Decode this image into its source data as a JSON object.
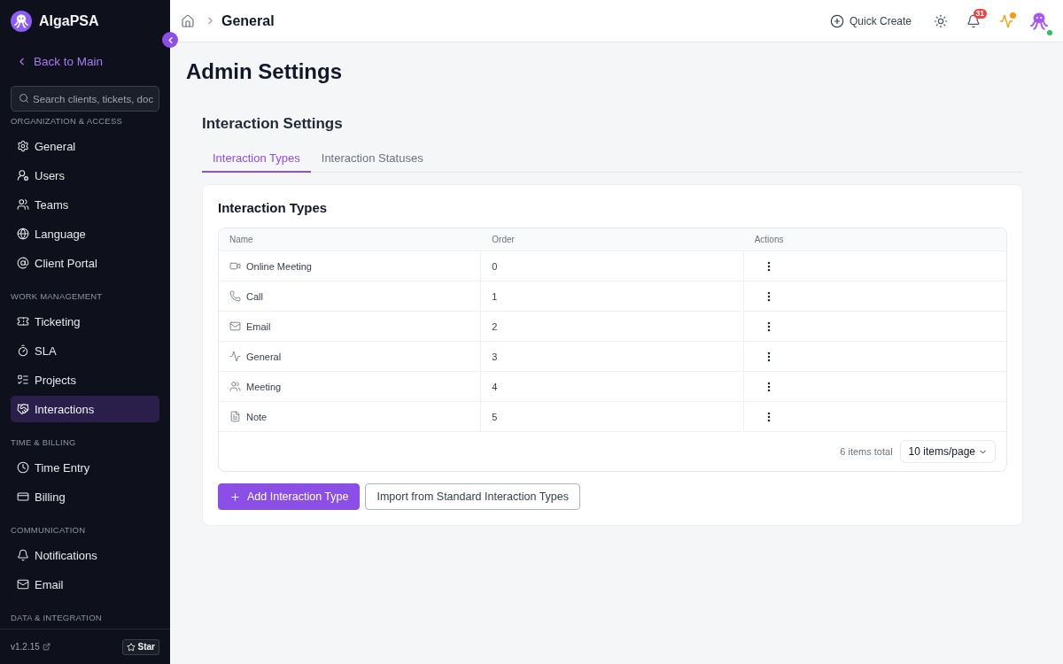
{
  "sidebar": {
    "brand": "AlgaPSA",
    "back_link": "Back to Main",
    "search": {
      "placeholder": "Search clients, tickets, doc"
    },
    "sections": [
      {
        "title": "ORGANIZATION & ACCESS",
        "items": [
          {
            "label": "General",
            "selected": false
          },
          {
            "label": "Users",
            "selected": false
          },
          {
            "label": "Teams",
            "selected": false
          },
          {
            "label": "Language",
            "selected": false
          },
          {
            "label": "Client Portal",
            "selected": false
          }
        ]
      },
      {
        "title": "WORK MANAGEMENT",
        "items": [
          {
            "label": "Ticketing",
            "selected": false
          },
          {
            "label": "SLA",
            "selected": false
          },
          {
            "label": "Projects",
            "selected": false
          },
          {
            "label": "Interactions",
            "selected": true
          }
        ]
      },
      {
        "title": "TIME & BILLING",
        "items": [
          {
            "label": "Time Entry",
            "selected": false
          },
          {
            "label": "Billing",
            "selected": false
          }
        ]
      },
      {
        "title": "COMMUNICATION",
        "items": [
          {
            "label": "Notifications",
            "selected": false
          },
          {
            "label": "Email",
            "selected": false
          }
        ]
      },
      {
        "title": "DATA & INTEGRATION"
      }
    ],
    "version": "v1.2.15",
    "star_button": "Star"
  },
  "header": {
    "breadcrumb": "General",
    "quick_create": "Quick Create",
    "notification_count": "31",
    "activity": {
      "alert": true
    },
    "user": {
      "online": true
    }
  },
  "page_title": "Admin Settings",
  "settings": {
    "title": "Interaction Settings",
    "tabs": [
      {
        "label": "Interaction Types",
        "selected": true
      },
      {
        "label": "Interaction Statuses",
        "selected": false
      }
    ],
    "card": {
      "title": "Interaction Types",
      "table": {
        "columns": [
          "Name",
          "Order",
          "Actions"
        ],
        "rows": [
          {
            "kind": "video",
            "name": "Online Meeting",
            "order": "0"
          },
          {
            "kind": "phone",
            "name": "Call",
            "order": "1"
          },
          {
            "kind": "mail",
            "name": "Email",
            "order": "2"
          },
          {
            "kind": "pulse",
            "name": "General",
            "order": "3"
          },
          {
            "kind": "people",
            "name": "Meeting",
            "order": "4"
          },
          {
            "kind": "note",
            "name": "Note",
            "order": "5"
          }
        ]
      },
      "total": "6 items total",
      "page_size": "10 items/page",
      "buttons": [
        {
          "kind": "primary",
          "label": "Add Interaction Type"
        },
        {
          "kind": "outline",
          "label": "Import from Standard Interaction Types"
        }
      ]
    }
  }
}
